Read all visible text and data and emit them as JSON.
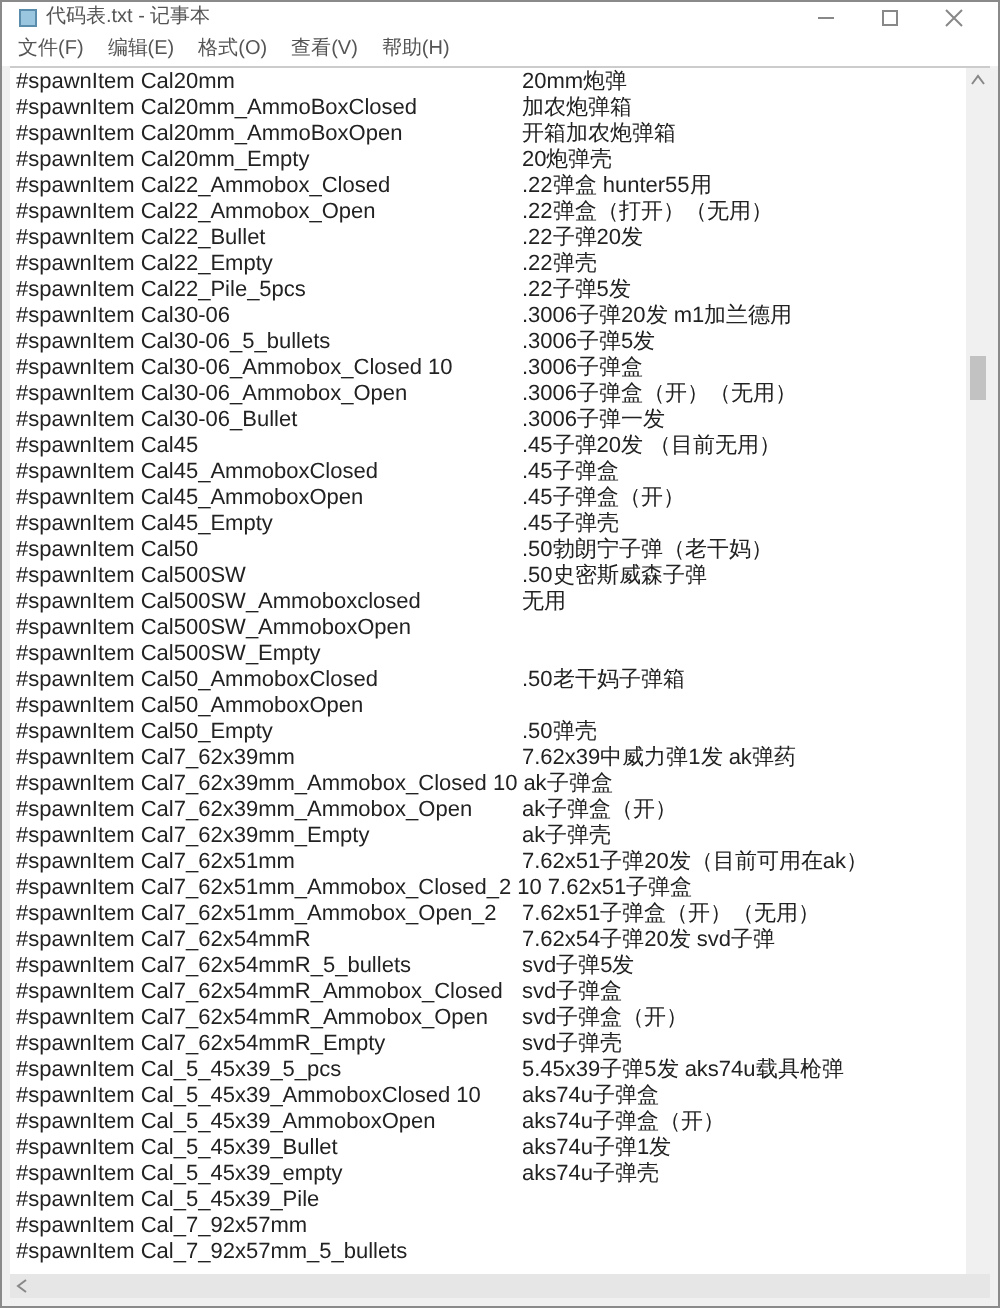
{
  "window": {
    "title": "代码表.txt - 记事本"
  },
  "menu": [
    "文件(F)",
    "编辑(E)",
    "格式(O)",
    "查看(V)",
    "帮助(H)"
  ],
  "lines": [
    {
      "code": "#spawnItem Cal20mm",
      "desc": "20mm炮弹"
    },
    {
      "code": "#spawnItem Cal20mm_AmmoBoxClosed",
      "desc": "加农炮弹箱"
    },
    {
      "code": "#spawnItem Cal20mm_AmmoBoxOpen",
      "desc": "开箱加农炮弹箱"
    },
    {
      "code": "#spawnItem Cal20mm_Empty",
      "desc": "20炮弹壳"
    },
    {
      "code": "#spawnItem Cal22_Ammobox_Closed",
      "desc": ".22弹盒 hunter55用"
    },
    {
      "code": "#spawnItem Cal22_Ammobox_Open",
      "desc": ".22弹盒（打开）（无用）"
    },
    {
      "code": "#spawnItem Cal22_Bullet",
      "desc": ".22子弹20发"
    },
    {
      "code": "#spawnItem Cal22_Empty",
      "desc": ".22弹壳"
    },
    {
      "code": "#spawnItem Cal22_Pile_5pcs",
      "desc": ".22子弹5发"
    },
    {
      "code": "#spawnItem Cal30-06",
      "desc": ".3006子弹20发 m1加兰德用"
    },
    {
      "code": "#spawnItem Cal30-06_5_bullets",
      "desc": ".3006子弹5发"
    },
    {
      "code": "#spawnItem Cal30-06_Ammobox_Closed 10",
      "desc": ".3006子弹盒"
    },
    {
      "code": "#spawnItem Cal30-06_Ammobox_Open",
      "desc": ".3006子弹盒（开）（无用）"
    },
    {
      "code": "#spawnItem Cal30-06_Bullet",
      "desc": ".3006子弹一发"
    },
    {
      "code": "#spawnItem Cal45",
      "desc": ".45子弹20发 （目前无用）"
    },
    {
      "code": "#spawnItem Cal45_AmmoboxClosed",
      "desc": ".45子弹盒"
    },
    {
      "code": "#spawnItem Cal45_AmmoboxOpen",
      "desc": ".45子弹盒（开）"
    },
    {
      "code": "#spawnItem Cal45_Empty",
      "desc": ".45子弹壳"
    },
    {
      "code": "#spawnItem Cal50",
      "desc": ".50勃朗宁子弹（老干妈）"
    },
    {
      "code": "#spawnItem Cal500SW",
      "desc": ".50史密斯威森子弹"
    },
    {
      "code": "#spawnItem Cal500SW_Ammoboxclosed",
      "desc": "无用"
    },
    {
      "code": "#spawnItem Cal500SW_AmmoboxOpen"
    },
    {
      "code": "#spawnItem Cal500SW_Empty"
    },
    {
      "code": "#spawnItem Cal50_AmmoboxClosed",
      "desc": ".50老干妈子弹箱"
    },
    {
      "code": "#spawnItem Cal50_AmmoboxOpen"
    },
    {
      "code": "#spawnItem Cal50_Empty",
      "desc": ".50弹壳"
    },
    {
      "code": "#spawnItem Cal7_62x39mm",
      "desc": "7.62x39中威力弹1发 ak弹药"
    },
    {
      "code": "#spawnItem Cal7_62x39mm_Ammobox_Closed 10",
      "desc": "ak子弹盒"
    },
    {
      "code": "#spawnItem Cal7_62x39mm_Ammobox_Open",
      "desc": "ak子弹盒（开）"
    },
    {
      "code": "#spawnItem Cal7_62x39mm_Empty",
      "desc": "ak子弹壳"
    },
    {
      "code": "#spawnItem Cal7_62x51mm",
      "desc": "7.62x51子弹20发（目前可用在ak）"
    },
    {
      "code": "#spawnItem Cal7_62x51mm_Ammobox_Closed_2 10",
      "desc": "7.62x51子弹盒"
    },
    {
      "code": "#spawnItem Cal7_62x51mm_Ammobox_Open_2",
      "desc": "7.62x51子弹盒（开）（无用）"
    },
    {
      "code": "#spawnItem Cal7_62x54mmR",
      "desc": "7.62x54子弹20发 svd子弹"
    },
    {
      "code": "#spawnItem Cal7_62x54mmR_5_bullets",
      "desc": "svd子弹5发"
    },
    {
      "code": "#spawnItem Cal7_62x54mmR_Ammobox_Closed",
      "desc": "svd子弹盒"
    },
    {
      "code": "#spawnItem Cal7_62x54mmR_Ammobox_Open",
      "desc": "svd子弹盒（开）"
    },
    {
      "code": "#spawnItem Cal7_62x54mmR_Empty",
      "desc": "svd子弹壳"
    },
    {
      "code": "#spawnItem Cal_5_45x39_5_pcs",
      "desc": "5.45x39子弹5发 aks74u载具枪弹"
    },
    {
      "code": "#spawnItem Cal_5_45x39_AmmoboxClosed 10",
      "desc": "aks74u子弹盒"
    },
    {
      "code": "#spawnItem Cal_5_45x39_AmmoboxOpen",
      "desc": "aks74u子弹盒（开）"
    },
    {
      "code": "#spawnItem Cal_5_45x39_Bullet",
      "desc": "aks74u子弹1发"
    },
    {
      "code": "#spawnItem Cal_5_45x39_empty",
      "desc": "aks74u子弹壳"
    },
    {
      "code": "#spawnItem Cal_5_45x39_Pile"
    },
    {
      "code": "#spawnItem Cal_7_92x57mm"
    },
    {
      "code": "#spawnItem Cal_7_92x57mm_5_bullets"
    }
  ]
}
